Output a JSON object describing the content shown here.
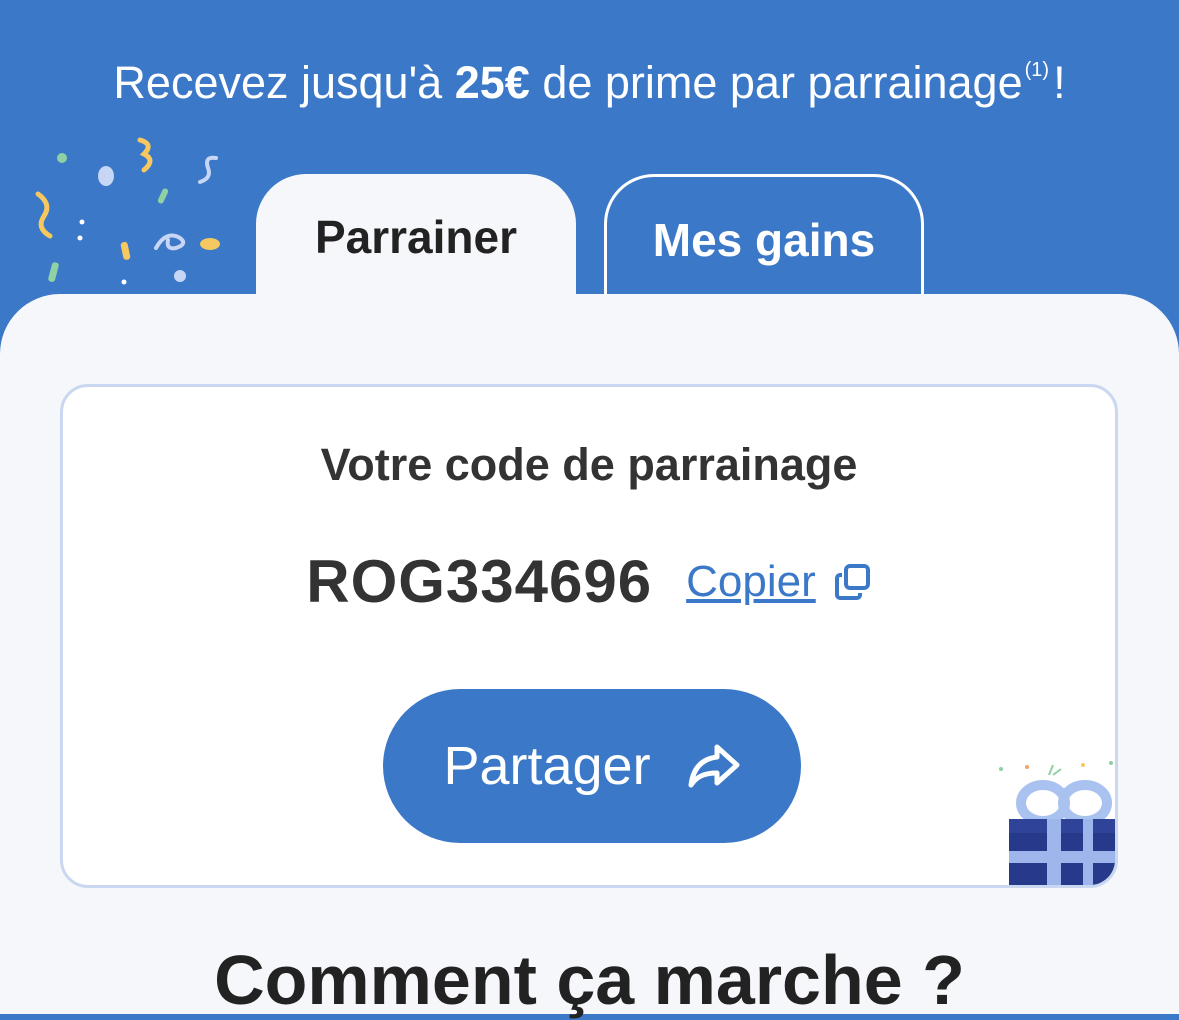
{
  "banner": {
    "prefix": "Recevez jusqu'à",
    "amount": "25€",
    "middle": "de prime par parrainage",
    "footnote": "(1)",
    "suffix": "!"
  },
  "tabs": [
    {
      "label": "Parrainer",
      "active": true
    },
    {
      "label": "Mes gains",
      "active": false
    }
  ],
  "card": {
    "title": "Votre code de parrainage",
    "code": "ROG334696",
    "copy_label": "Copier",
    "share_label": "Partager"
  },
  "bottom_heading": "Comment ça marche ?",
  "icons": {
    "copy": "copy-icon",
    "share": "share-arrow-icon",
    "gift": "gift-illustration",
    "confetti": "confetti-illustration"
  },
  "colors": {
    "primary": "#3b78c8",
    "panel": "#f5f7fa",
    "text": "#333333",
    "card_border": "#c9d7f0"
  }
}
